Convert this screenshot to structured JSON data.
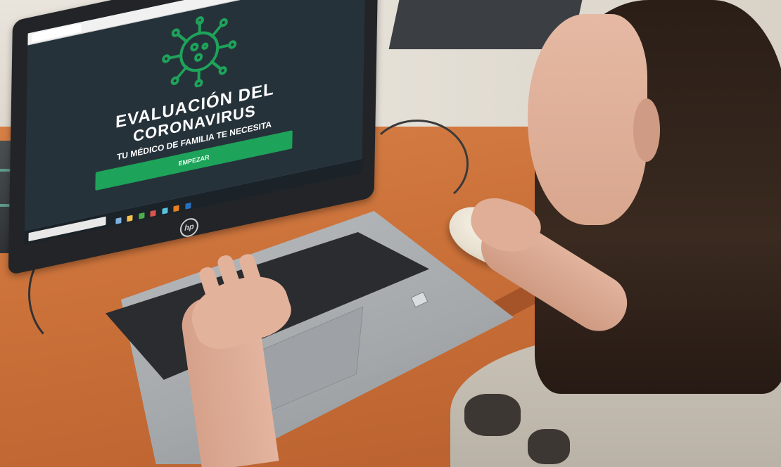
{
  "photo": {
    "description_tag": "photo"
  },
  "screen": {
    "heading_line_1": "EVALUACIÓN DEL",
    "heading_line_2": "CORONAVIRUS",
    "subheading": "TU MÉDICO DE FAMILIA TE NECESITA",
    "button_label": "EMPEZAR",
    "virus_icon": "virus-icon",
    "accent_color": "#1ea35a"
  },
  "laptop": {
    "brand_logo_text": "hp"
  }
}
